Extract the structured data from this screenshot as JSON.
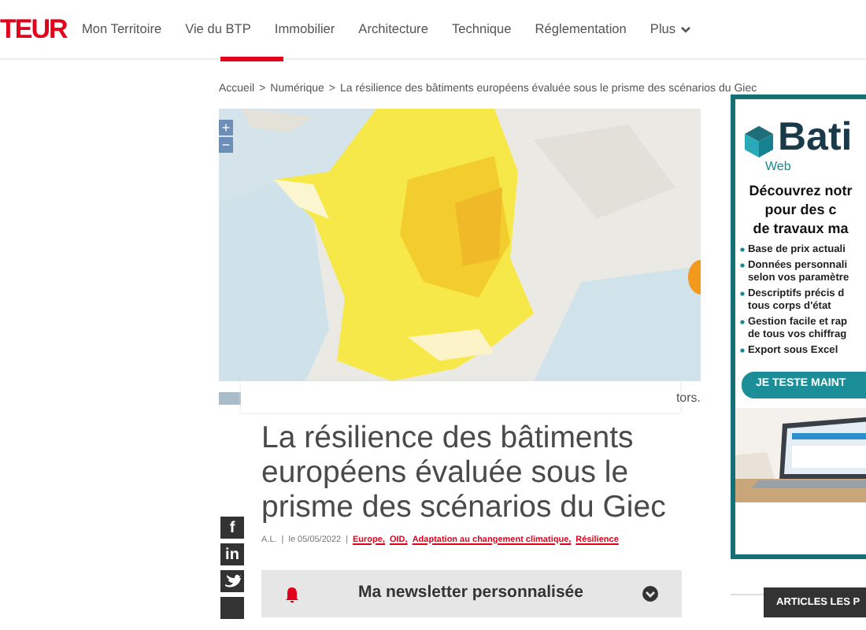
{
  "logo": "TEUR",
  "nav": [
    {
      "label": "Mon Territoire",
      "dropdown": false
    },
    {
      "label": "Vie du BTP",
      "dropdown": false
    },
    {
      "label": "Immobilier",
      "dropdown": false
    },
    {
      "label": "Architecture",
      "dropdown": false
    },
    {
      "label": "Technique",
      "dropdown": false
    },
    {
      "label": "Réglementation",
      "dropdown": false
    },
    {
      "label": "Plus",
      "dropdown": true
    }
  ],
  "breadcrumb": {
    "separator": ">",
    "items": [
      "Accueil",
      "Numérique",
      "La résilience des bâtiments européens évaluée sous le prisme des scénarios du Giec"
    ]
  },
  "map": {
    "zoom_in": "+",
    "zoom_out": "−",
    "caption_tail": "tors."
  },
  "article": {
    "title": "La résilience des bâtiments européens évaluée sous le prisme des scénarios du Giec",
    "author": "A.L.",
    "separator": "|",
    "date": "le 05/05/2022",
    "tags": [
      "Europe,",
      "OID,",
      "Adaptation au changement climatique,",
      "Résilience"
    ]
  },
  "share": [
    {
      "kind": "text",
      "label": "f"
    },
    {
      "kind": "text",
      "label": "in"
    },
    {
      "kind": "bird"
    },
    {
      "kind": "blank"
    }
  ],
  "newsletter": {
    "label": "Ma newsletter personnalisée"
  },
  "ad": {
    "brand": "Bati",
    "sub": "Web",
    "headline": [
      "Découvrez notr",
      "pour des c",
      "de travaux ma"
    ],
    "bullets": [
      [
        "Base de prix actuali"
      ],
      [
        "Données personnali",
        "selon vos paramètre"
      ],
      [
        "Descriptifs précis d",
        "tous corps d'état"
      ],
      [
        "Gestion facile et rap",
        "de tous vos chiffrag"
      ],
      [
        "Export sous Excel"
      ]
    ],
    "cta": "JE TESTE MAINT"
  },
  "sidebar_button": "ARTICLES LES P"
}
